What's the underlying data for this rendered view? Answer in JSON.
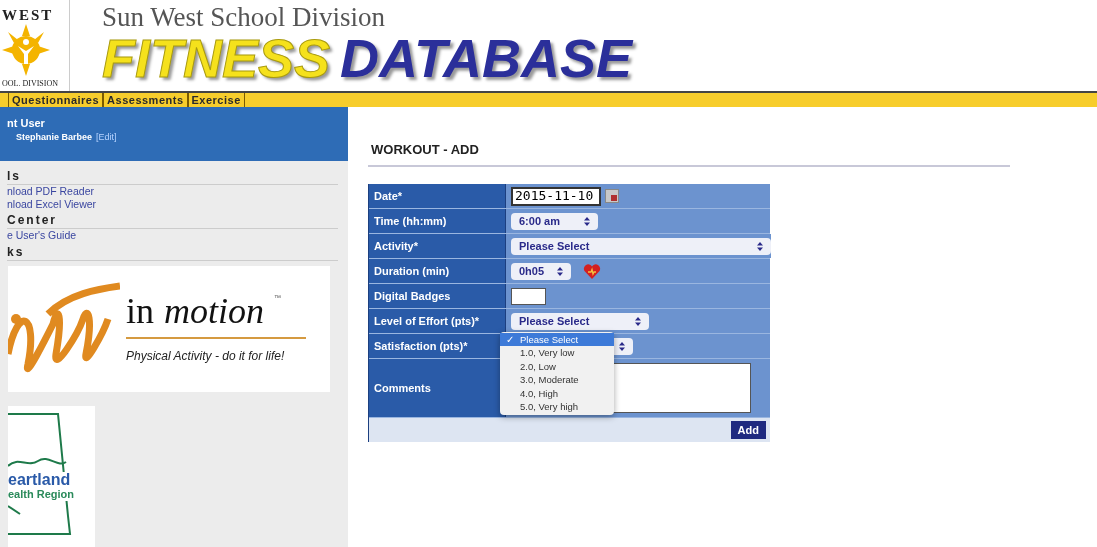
{
  "header": {
    "logo_texts": [
      "WEST",
      "OOL. DIVISION"
    ],
    "subtitle": "Sun West School Division",
    "title_primary": "FITNESS",
    "title_secondary": "DATABASE"
  },
  "nav": [
    {
      "label": "Questionnaires"
    },
    {
      "label": "Assessments"
    },
    {
      "label": "Exercise"
    }
  ],
  "sidebar": {
    "user": {
      "heading": "nt User",
      "name": "Stephanie Barbee",
      "edit_link": "[Edit]"
    },
    "sections": [
      {
        "heading": "ls",
        "links": [
          "nload PDF Reader",
          "nload Excel Viewer"
        ]
      },
      {
        "heading": "Center",
        "links": [
          "e User's Guide"
        ]
      },
      {
        "heading": "ks"
      }
    ],
    "in_motion": {
      "word_1": "in",
      "word_2": "motion",
      "tm": "™",
      "tagline": "Physical Activity - do it for life!"
    },
    "heartland": {
      "line_1": "eartland",
      "line_2": "ealth Region"
    }
  },
  "form": {
    "title": "WORKOUT - ADD",
    "rows": [
      {
        "label": "Date*",
        "kind": "date",
        "value": "2015-11-10"
      },
      {
        "label": "Time (hh:mm)",
        "kind": "select",
        "value": "6:00 am"
      },
      {
        "label": "Activity*",
        "kind": "select",
        "value": "Please Select"
      },
      {
        "label": "Duration (min)",
        "kind": "select",
        "value": "0h05",
        "heart": true
      },
      {
        "label": "Digital Badges",
        "kind": "text"
      },
      {
        "label": "Level of Effort (pts)*",
        "kind": "select",
        "value": "Please Select"
      },
      {
        "label": "Satisfaction (pts)*",
        "kind": "open_select",
        "check_mark": "✓",
        "options": [
          {
            "label": "Please Select",
            "selected": true
          },
          {
            "label": "1.0, Very low",
            "selected": false
          },
          {
            "label": "2.0, Low",
            "selected": false
          },
          {
            "label": "3.0, Moderate",
            "selected": false
          },
          {
            "label": "4.0, High",
            "selected": false
          },
          {
            "label": "5.0, Very high",
            "selected": false
          }
        ]
      },
      {
        "label": "Comments",
        "kind": "textarea"
      }
    ],
    "submit": "Add"
  }
}
